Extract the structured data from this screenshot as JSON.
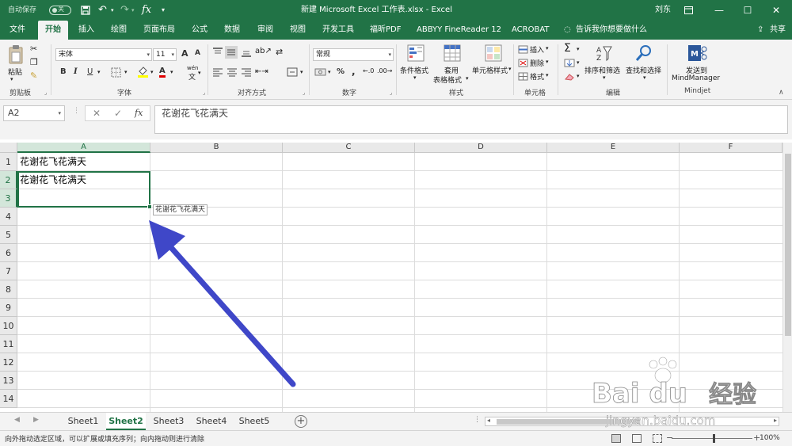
{
  "titlebar": {
    "autosave": "自动保存",
    "toggle": "关",
    "fx_symbol": "fx",
    "title": "新建 Microsoft Excel 工作表.xlsx  -  Excel",
    "user": "刘东",
    "brand_color": "#217346"
  },
  "tabs": [
    "文件",
    "开始",
    "插入",
    "绘图",
    "页面布局",
    "公式",
    "数据",
    "审阅",
    "视图",
    "开发工具",
    "福昕PDF",
    "ABBYY FineReader 12",
    "ACROBAT"
  ],
  "tab_search": "告诉我你想要做什么",
  "share": "共享",
  "ribbon": {
    "clipboard": {
      "paste": "粘贴",
      "label": "剪贴板"
    },
    "font": {
      "name": "宋体",
      "size": "11",
      "label": "字体",
      "grow": "A",
      "shrink": "A",
      "bold": "B",
      "italic": "I",
      "underline": "U",
      "font_color": "A",
      "wen": "wén",
      "wen_char": "文"
    },
    "alignment": {
      "label": "对齐方式"
    },
    "number": {
      "format": "常规",
      "percent": "%",
      "comma": ",",
      "label": "数字"
    },
    "styles": {
      "conditional": "条件格式",
      "table_1": "套用",
      "table_2": "表格格式",
      "cell_styles": "单元格样式",
      "label": "样式"
    },
    "cells": {
      "insert": "插入",
      "delete": "删除",
      "format": "格式",
      "label": "单元格"
    },
    "editing": {
      "sum": "Σ",
      "sort": "排序和筛选",
      "find": "查找和选择",
      "label": "编辑"
    },
    "mindjet": {
      "send_1": "发送到",
      "send_2": "MindManager",
      "label": "Mindjet"
    }
  },
  "formula_bar": {
    "name_box": "A2",
    "cancel": "✕",
    "enter": "✓",
    "fx": "fx",
    "content": "花谢花飞花满天"
  },
  "grid": {
    "columns": [
      "A",
      "B",
      "C",
      "D",
      "E",
      "F"
    ],
    "rows": [
      "1",
      "2",
      "3",
      "4",
      "5",
      "6",
      "7",
      "8",
      "9",
      "10",
      "11",
      "12",
      "13",
      "14"
    ],
    "cells": {
      "A1": "花谢花飞花满天",
      "A2": "花谢花飞花满天"
    },
    "fill_tooltip": "花谢花飞花满天"
  },
  "sheets": [
    "Sheet1",
    "Sheet2",
    "Sheet3",
    "Sheet4",
    "Sheet5"
  ],
  "active_sheet": "Sheet2",
  "add_sheet": "+",
  "statusbar": {
    "message": "向外拖动选定区域，可以扩展或填充序列；向内拖动则进行清除",
    "zoom_minus": "−",
    "zoom_plus": "+",
    "zoom": "100%"
  },
  "annotation_color": "#3f47c8",
  "watermark": {
    "brand": "Bai du",
    "word": "经验",
    "url": "jingyan.baidu.com"
  }
}
